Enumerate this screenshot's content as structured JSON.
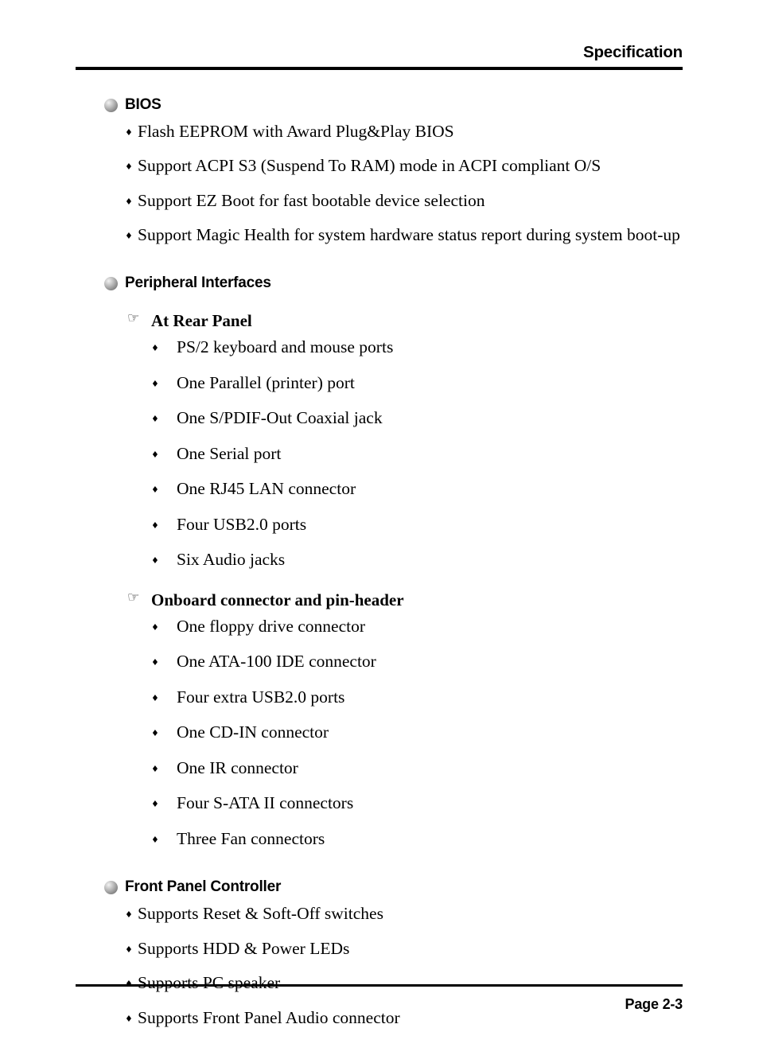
{
  "header": {
    "title": "Specification"
  },
  "footer": {
    "page_label": "Page 2-3"
  },
  "icons": {
    "sphere_bullet": "sphere-bullet-icon",
    "diamond_bullet": "♦",
    "hand_marker": "☞"
  },
  "sections": [
    {
      "title": "BIOS",
      "items": [
        "Flash EEPROM with Award Plug&Play BIOS",
        "Support ACPI S3 (Suspend To RAM) mode in ACPI compliant O/S",
        "Support EZ Boot for fast bootable device selection",
        "Support Magic Health for system hardware status report during system boot-up"
      ]
    },
    {
      "title": "Peripheral Interfaces",
      "subsections": [
        {
          "title": "At Rear Panel",
          "items": [
            "PS/2 keyboard and mouse ports",
            "One Parallel (printer) port",
            "One S/PDIF-Out Coaxial jack",
            "One Serial port",
            "One RJ45 LAN connector",
            "Four USB2.0 ports",
            "Six Audio jacks"
          ]
        },
        {
          "title": "Onboard connector and pin-header",
          "items": [
            "One floppy drive connector",
            "One ATA-100 IDE connector",
            "Four extra USB2.0 ports",
            "One CD-IN connector",
            "One IR connector",
            "Four S-ATA II connectors",
            "Three Fan connectors"
          ]
        }
      ]
    },
    {
      "title": "Front Panel Controller",
      "items": [
        "Supports Reset & Soft-Off switches",
        "Supports HDD & Power LEDs",
        "Supports PC speaker",
        "Supports Front Panel Audio connector"
      ]
    }
  ]
}
